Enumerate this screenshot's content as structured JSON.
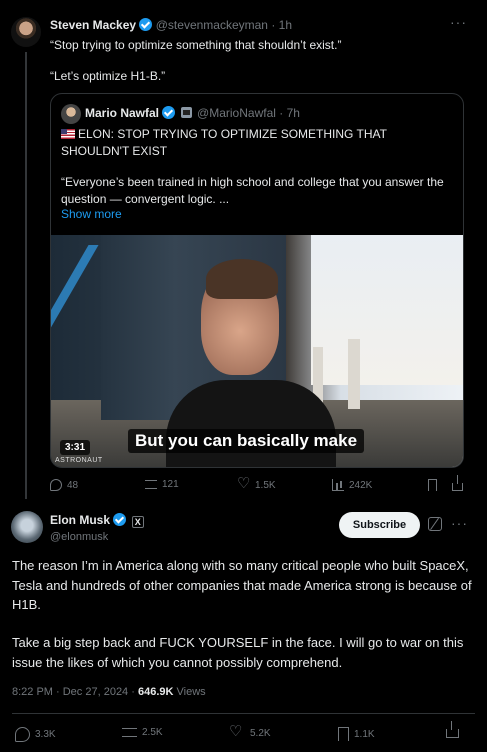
{
  "reply": {
    "name": "Steven Mackey",
    "handle": "@stevenmackeyman",
    "time": "1h",
    "line1": "“Stop trying to optimize something that shouldn’t exist.”",
    "line2": "“Let’s optimize H1-B.”",
    "quote": {
      "name": "Mario Nawfal",
      "handle": "@MarioNawfal",
      "time": "7h",
      "headline": "ELON: STOP TRYING TO OPTIMIZE SOMETHING THAT SHOULDN'T EXIST",
      "body": "“Everyone’s been trained in high school and college that you answer the question — convergent logic. ...",
      "show_more": "Show more",
      "video": {
        "subtitle": "But you can basically make",
        "duration": "3:31",
        "watermark": "ASTRONAUT"
      }
    },
    "actions": {
      "replies": "48",
      "reposts": "121",
      "likes": "1.5K",
      "views": "242K"
    }
  },
  "main": {
    "name": "Elon Musk",
    "handle": "@elonmusk",
    "x_badge": "X",
    "subscribe_label": "Subscribe",
    "paragraph1": "The reason I’m in America along with so many critical people who built SpaceX, Tesla and hundreds of other companies that made America strong is because of H1B.",
    "paragraph2": "Take a big step back and FUCK YOURSELF in the face. I will go to war on this issue the likes of which you cannot possibly comprehend.",
    "timestamp": "8:22 PM · Dec 27, 2024",
    "views_count": "646.9K",
    "views_label": "Views",
    "actions": {
      "replies": "3.3K",
      "reposts": "2.5K",
      "likes": "5.2K",
      "bookmarks": "1.1K"
    }
  }
}
